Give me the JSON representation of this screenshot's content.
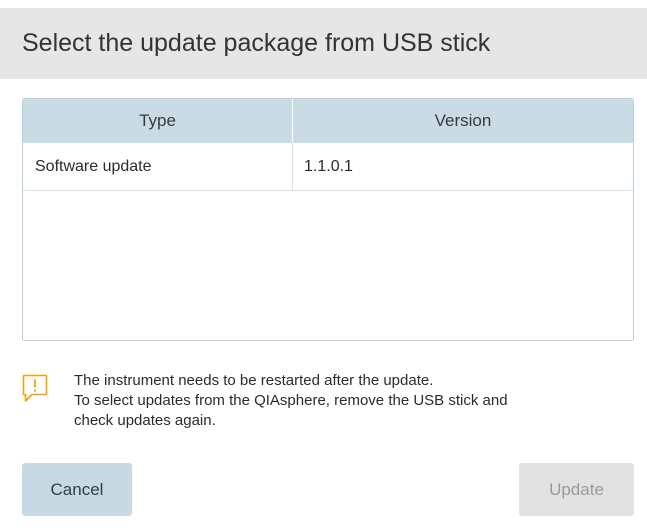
{
  "dialog": {
    "title": "Select the update package from USB stick"
  },
  "table": {
    "columns": [
      "Type",
      "Version"
    ],
    "rows": [
      {
        "type": "Software update",
        "version": "1.1.0.1"
      }
    ]
  },
  "notice": {
    "icon": "warning-speech-bubble-icon",
    "icon_color": "#f0a30a",
    "line1": "The instrument needs to be restarted after the update.",
    "line2": "To select updates from the QIAsphere, remove the USB stick and",
    "line3": "check updates again."
  },
  "buttons": {
    "cancel_label": "Cancel",
    "update_label": "Update",
    "update_enabled": false
  }
}
